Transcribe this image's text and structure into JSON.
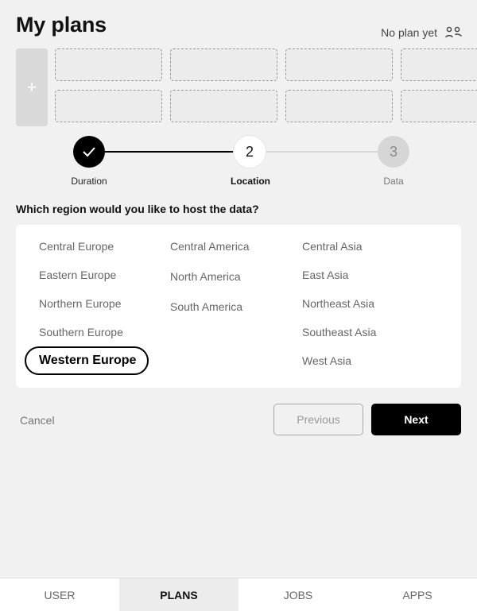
{
  "header": {
    "title": "My plans",
    "no_plan_label": "No plan yet",
    "no_plan_icon": "users-outline-icon"
  },
  "plans": {
    "add_label": "+",
    "slot_count": 8
  },
  "stepper": {
    "steps": [
      {
        "label": "Duration",
        "status": "completed",
        "marker": "✓"
      },
      {
        "label": "Location",
        "status": "active",
        "marker": "2"
      },
      {
        "label": "Data",
        "status": "upcoming",
        "marker": "3"
      }
    ]
  },
  "question": "Which region would you like to host the data?",
  "regions": {
    "europe": [
      "Central Europe",
      "Eastern Europe",
      "Northern Europe",
      "Southern Europe",
      "Western Europe"
    ],
    "america": [
      "Central America",
      "North America",
      "South America"
    ],
    "asia": [
      "Central Asia",
      "East Asia",
      "Northeast Asia",
      "Southeast Asia",
      "West Asia"
    ],
    "selected": "Western Europe"
  },
  "actions": {
    "cancel": "Cancel",
    "previous": "Previous",
    "next": "Next"
  },
  "nav": {
    "items": [
      {
        "label": "USER",
        "active": false
      },
      {
        "label": "PLANS",
        "active": true
      },
      {
        "label": "JOBS",
        "active": false
      },
      {
        "label": "APPS",
        "active": false
      }
    ]
  },
  "colors": {
    "background": "#f1f1f1",
    "accent": "#000000",
    "muted_text": "#666666"
  }
}
